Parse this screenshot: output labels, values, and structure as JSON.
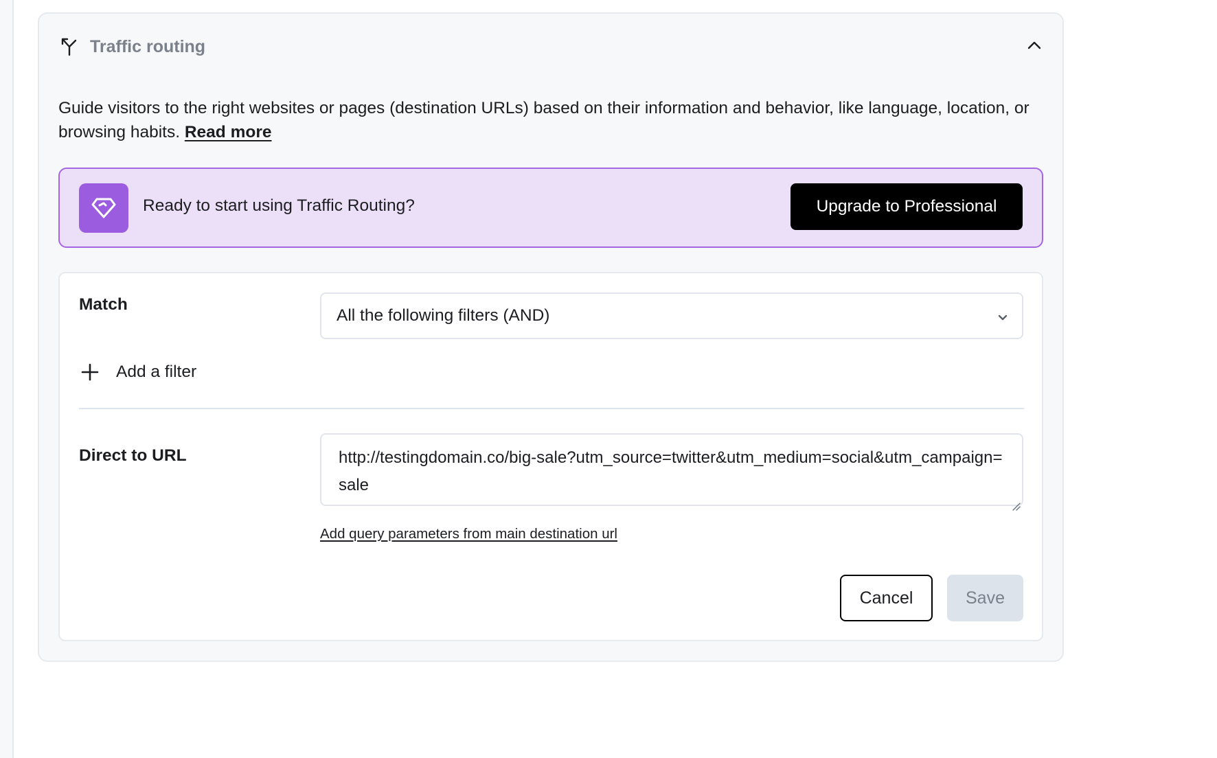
{
  "section": {
    "title": "Traffic routing",
    "icon": "split-arrow-icon",
    "collapse_icon": "chevron-up-icon",
    "description": "Guide visitors to the right websites or pages (destination URLs) based on their information and behavior, like language, location, or browsing habits.",
    "read_more_label": "Read more"
  },
  "upgrade_banner": {
    "icon": "diamond-icon",
    "text": "Ready to start using Traffic Routing?",
    "button_label": "Upgrade to Professional",
    "accent_color": "#9b5ce0",
    "background_color": "#ecdff8"
  },
  "rule": {
    "match_label": "Match",
    "match_value": "All the following filters (AND)",
    "add_filter_label": "Add a filter",
    "direct_url_label": "Direct to URL",
    "direct_url_value": "http://testingdomain.co/big-sale?utm_source=twitter&utm_medium=social&utm_campaign=sale",
    "query_params_link": "Add query parameters from main destination url",
    "cancel_label": "Cancel",
    "save_label": "Save",
    "save_disabled": true
  }
}
